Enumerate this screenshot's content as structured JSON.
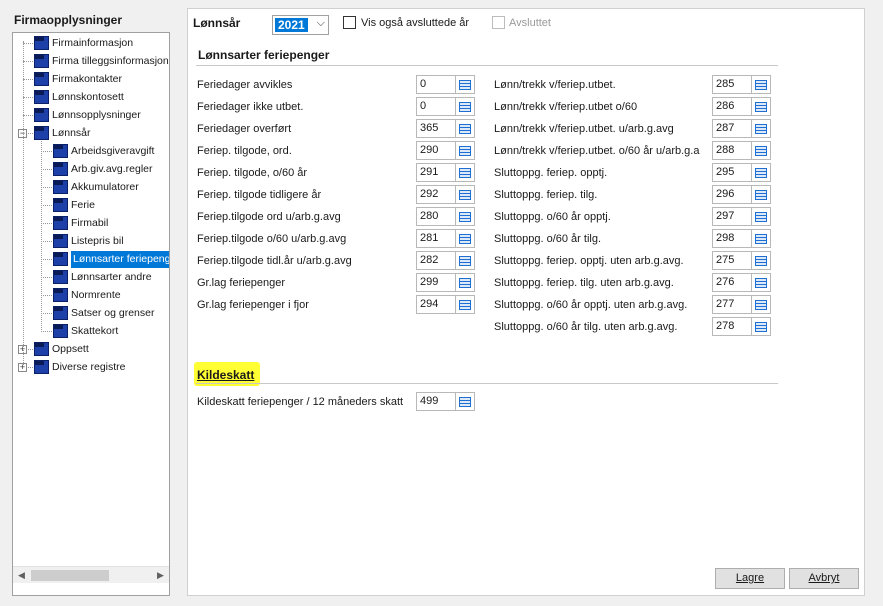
{
  "left_panel": {
    "title": "Firmaopplysninger",
    "tree": [
      {
        "label": "Firmainformasjon"
      },
      {
        "label": "Firma tilleggsinformasjon"
      },
      {
        "label": "Firmakontakter"
      },
      {
        "label": "Lønnskontosett"
      },
      {
        "label": "Lønnsopplysninger"
      },
      {
        "label": "Lønnsår",
        "expander": "−"
      },
      {
        "label": "Arbeidsgiveravgift"
      },
      {
        "label": "Arb.giv.avg.regler"
      },
      {
        "label": "Akkumulatorer"
      },
      {
        "label": "Ferie"
      },
      {
        "label": "Firmabil"
      },
      {
        "label": "Listepris bil"
      },
      {
        "label": "Lønnsarter feriepenger"
      },
      {
        "label": "Lønnsarter andre"
      },
      {
        "label": "Normrente"
      },
      {
        "label": "Satser og grenser"
      },
      {
        "label": "Skattekort"
      },
      {
        "label": "Oppsett",
        "expander": "+"
      },
      {
        "label": "Diverse registre",
        "expander": "+"
      }
    ],
    "scroll_left": "◀",
    "scroll_right": "▶"
  },
  "header": {
    "year_label": "Lønnsår",
    "year_value": "2021",
    "chevron": "⌵",
    "show_closed_label": "Vis også avsluttede år",
    "closed_label": "Avsluttet"
  },
  "feriepenger": {
    "heading": "Lønnsarter feriepenger",
    "left": [
      {
        "label": "Feriedager avvikles",
        "value": "0"
      },
      {
        "label": "Feriedager ikke utbet.",
        "value": "0"
      },
      {
        "label": "Feriedager overført",
        "value": "365"
      },
      {
        "label": "Feriep. tilgode, ord.",
        "value": "290"
      },
      {
        "label": "Feriep. tilgode, o/60 år",
        "value": "291"
      },
      {
        "label": "Feriep. tilgode tidligere år",
        "value": "292"
      },
      {
        "label": "Feriep.tilgode ord u/arb.g.avg",
        "value": "280"
      },
      {
        "label": "Feriep.tilgode o/60 u/arb.g.avg",
        "value": "281"
      },
      {
        "label": "Feriep.tilgode tidl.år u/arb.g.avg",
        "value": "282"
      },
      {
        "label": "Gr.lag feriepenger",
        "value": "299"
      },
      {
        "label": "Gr.lag feriepenger i fjor",
        "value": "294"
      }
    ],
    "right": [
      {
        "label": "Lønn/trekk v/feriep.utbet.",
        "value": "285"
      },
      {
        "label": "Lønn/trekk v/feriep.utbet o/60",
        "value": "286"
      },
      {
        "label": "Lønn/trekk v/feriep.utbet. u/arb.g.avg",
        "value": "287"
      },
      {
        "label": "Lønn/trekk v/feriep.utbet. o/60 år u/arb.g.a",
        "value": "288"
      },
      {
        "label": "Sluttoppg. feriep. opptj.",
        "value": "295"
      },
      {
        "label": "Sluttoppg. feriep. tilg.",
        "value": "296"
      },
      {
        "label": "Sluttoppg. o/60 år opptj.",
        "value": "297"
      },
      {
        "label": "Sluttoppg. o/60 år tilg.",
        "value": "298"
      },
      {
        "label": "Sluttoppg. feriep. opptj. uten arb.g.avg.",
        "value": "275"
      },
      {
        "label": "Sluttoppg. feriep. tilg. uten arb.g.avg.",
        "value": "276"
      },
      {
        "label": "Sluttoppg. o/60 år opptj. uten arb.g.avg.",
        "value": "277"
      },
      {
        "label": "Sluttoppg. o/60 år tilg. uten arb.g.avg.",
        "value": "278"
      }
    ]
  },
  "kildeskatt": {
    "heading": "Kildeskatt",
    "label": "Kildeskatt feriepenger / 12 måneders skatt",
    "value": "499"
  },
  "buttons": {
    "save": "Lagre",
    "cancel": "Avbryt"
  },
  "colors": {
    "selection": "#0078d7",
    "highlight": "#ffff33",
    "list_icon": "#1e6fd0"
  }
}
